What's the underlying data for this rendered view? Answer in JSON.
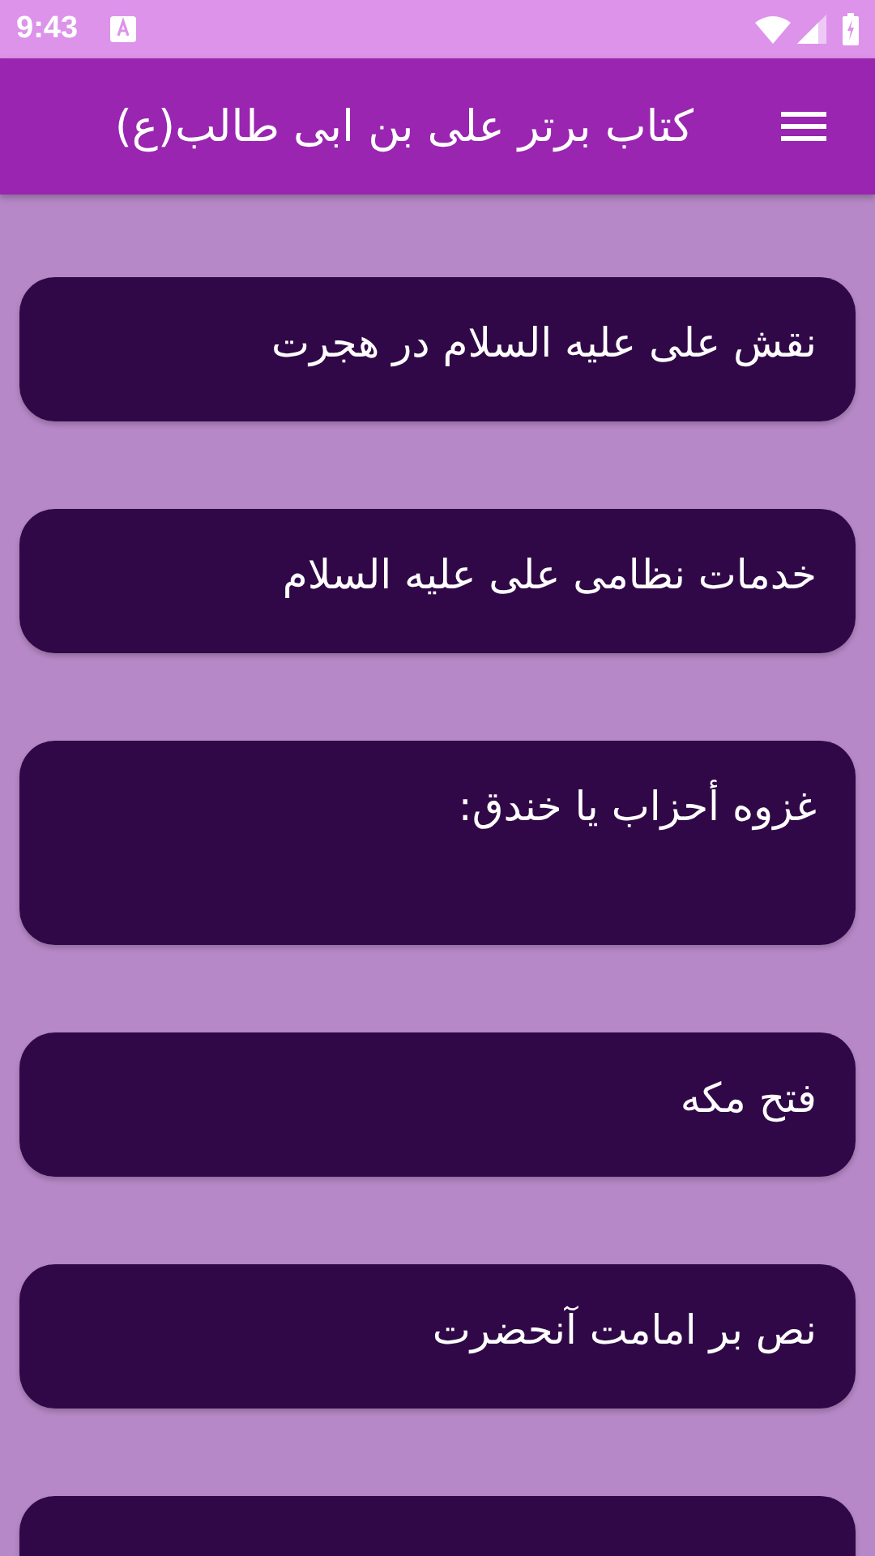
{
  "status_bar": {
    "time": "9:43"
  },
  "app_bar": {
    "title": "کتاب برتر علی بن ابی طالب(ع)"
  },
  "items": [
    {
      "title": "نقش علی علیه السلام در هجرت",
      "kind": "single"
    },
    {
      "title": "خدمات نظامی علی علیه السلام",
      "kind": "single"
    },
    {
      "title": "غزوه أحزاب یا خندق:",
      "kind": "tall"
    },
    {
      "title": "فتح مکه",
      "kind": "single"
    },
    {
      "title": "نص بر امامت آنحضرت",
      "kind": "single"
    },
    {
      "kind": "single"
    }
  ]
}
